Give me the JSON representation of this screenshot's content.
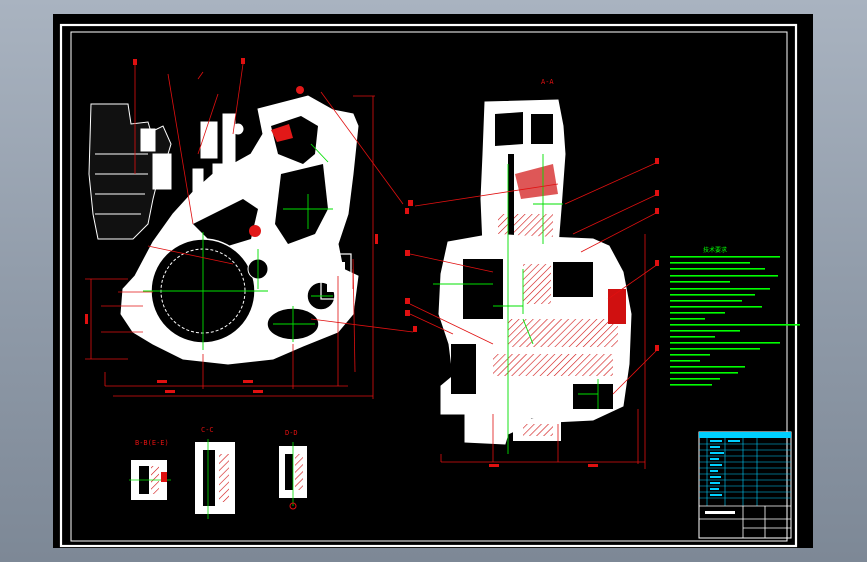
{
  "drawing": {
    "views": {
      "a_view": "A-A",
      "b_view": "B-B(E-E)",
      "c_view": "C-C",
      "d_view": "D-D"
    },
    "tech_requirements_title": "技术要求",
    "colors": {
      "background": "#000000",
      "frame": "#ffffff",
      "dimension": "#e01010",
      "centerline": "#00e000",
      "section_fill": "#ffffff",
      "section_hatch": "#ff2020",
      "notes_text": "#00ff00",
      "title_block": "#00d0ff"
    }
  }
}
